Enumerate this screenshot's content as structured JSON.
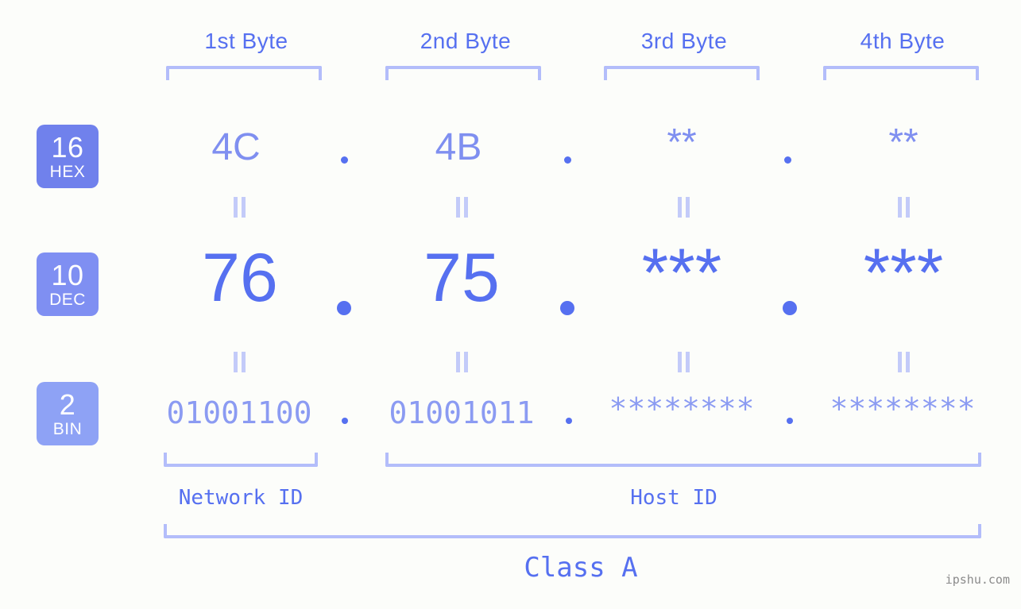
{
  "background_color": "#fcfdfa",
  "accent_colors": {
    "strong_blue": "#5670f0",
    "mid_blue": "#7f8ff0",
    "light_blue": "#b3bdfa",
    "pale_blue": "#c3cbf9",
    "badge_hex": "#7081ec",
    "badge_dec": "#7f8ff2",
    "badge_bin": "#8ea2f5",
    "watermark_gray": "#8b8b8b"
  },
  "headers": [
    {
      "label": "1st Byte"
    },
    {
      "label": "2nd Byte"
    },
    {
      "label": "3rd Byte"
    },
    {
      "label": "4th Byte"
    }
  ],
  "rows": [
    {
      "badge_number": "16",
      "badge_unit": "HEX",
      "badge_color": "#7081ec",
      "values": [
        "4C",
        "4B",
        "**",
        "**"
      ],
      "separator": "."
    },
    {
      "badge_number": "10",
      "badge_unit": "DEC",
      "badge_color": "#7f8ff2",
      "values": [
        "76",
        "75",
        "***",
        "***"
      ],
      "separator": "."
    },
    {
      "badge_number": "2",
      "badge_unit": "BIN",
      "badge_color": "#8ea2f5",
      "values": [
        "01001100",
        "01001011",
        "********",
        "********"
      ],
      "separator": "."
    }
  ],
  "equals_marks": {
    "glyph": "||",
    "count_per_gap": 4,
    "gaps": 2
  },
  "regions": [
    {
      "label": "Network ID",
      "spans_bytes": "1"
    },
    {
      "label": "Host ID",
      "spans_bytes": "2-4"
    }
  ],
  "class": {
    "label": "Class A",
    "spans_bytes": "1-4"
  },
  "watermark": "ipshu.com"
}
